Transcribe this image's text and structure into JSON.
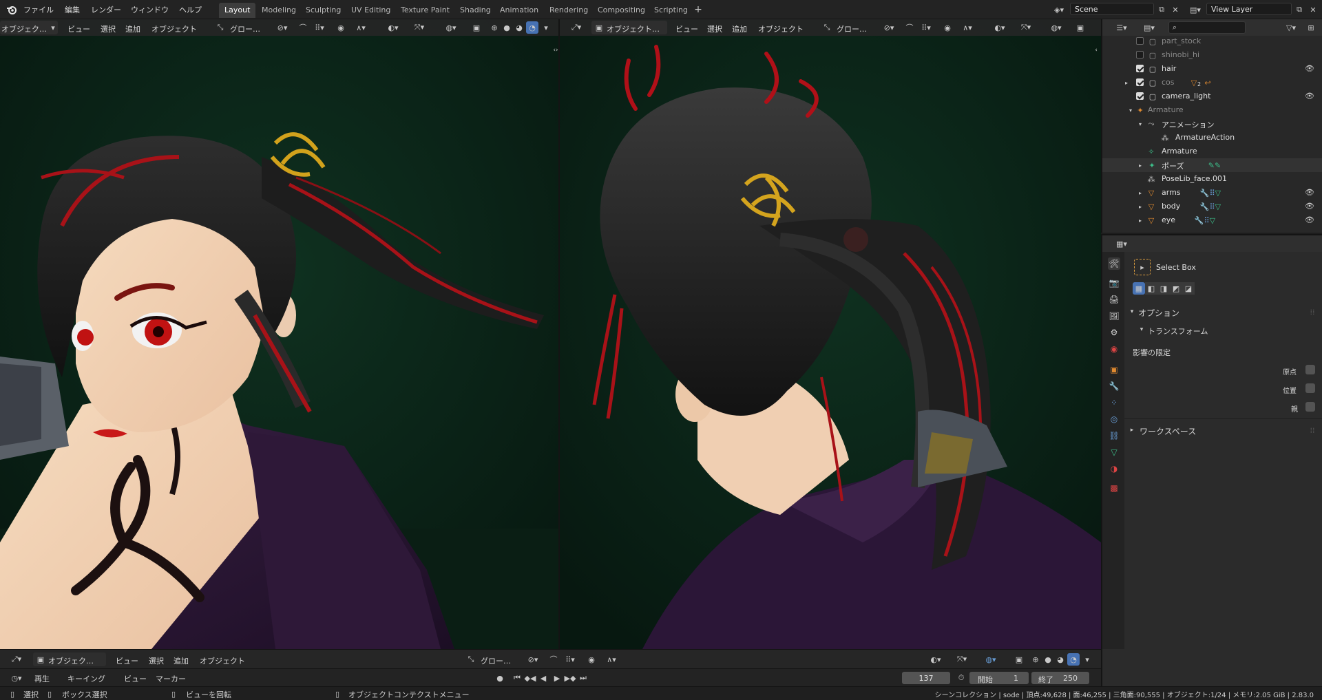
{
  "app": {
    "logo": "blender-logo"
  },
  "menu": [
    "ファイル",
    "編集",
    "レンダー",
    "ウィンドウ",
    "ヘルプ"
  ],
  "workspaces": [
    "Layout",
    "Modeling",
    "Sculpting",
    "UV Editing",
    "Texture Paint",
    "Shading",
    "Animation",
    "Rendering",
    "Compositing",
    "Scripting"
  ],
  "active_workspace": "Layout",
  "scene_name": "Scene",
  "view_layer": "View Layer",
  "viewport_left": {
    "mode": "オブジェク…",
    "menus": [
      "ビュー",
      "選択",
      "追加",
      "オブジェクト"
    ],
    "orientation": "グロー…"
  },
  "viewport_right": {
    "mode": "オブジェクト…",
    "menus": [
      "ビュー",
      "選択",
      "追加",
      "オブジェクト"
    ],
    "orientation": "グロー…"
  },
  "bottom_header": {
    "mode": "オブジェク…",
    "menus": [
      "ビュー",
      "選択",
      "追加",
      "オブジェクト"
    ],
    "orientation": "グロー…"
  },
  "outliner": {
    "search_placeholder": "",
    "rows": [
      {
        "label": "part_stock",
        "checked": false,
        "dim": true,
        "eye": false
      },
      {
        "label": "shinobi_hi",
        "checked": false,
        "dim": true,
        "eye": false
      },
      {
        "label": "hair",
        "checked": true,
        "dim": false,
        "eye": true
      },
      {
        "label": "cos",
        "checked": true,
        "dim": true,
        "eye": false,
        "extra": "2"
      },
      {
        "label": "camera_light",
        "checked": true,
        "dim": false,
        "eye": true
      },
      {
        "label": "Armature",
        "checked": null,
        "dim": true,
        "eye": false
      },
      {
        "label": "アニメーション",
        "checked": null,
        "dim": false,
        "eye": false
      },
      {
        "label": "ArmatureAction",
        "checked": null,
        "dim": false,
        "eye": false
      },
      {
        "label": "Armature",
        "checked": null,
        "dim": false,
        "eye": false
      },
      {
        "label": "ポーズ",
        "checked": null,
        "dim": false,
        "eye": false
      },
      {
        "label": "PoseLib_face.001",
        "checked": null,
        "dim": false,
        "eye": false
      },
      {
        "label": "arms",
        "checked": null,
        "dim": false,
        "eye": true
      },
      {
        "label": "body",
        "checked": null,
        "dim": false,
        "eye": true
      },
      {
        "label": "eye",
        "checked": null,
        "dim": false,
        "eye": true
      }
    ]
  },
  "properties": {
    "tool_name": "Select Box",
    "options_label": "オプション",
    "transform_label": "トランスフォーム",
    "affect_only_label": "影響の限定",
    "checks": [
      "原点",
      "位置",
      "親"
    ],
    "workspace_label": "ワークスペース"
  },
  "timeline": {
    "menus": [
      "再生",
      "キーイング",
      "ビュー",
      "マーカー"
    ],
    "current_frame": "137",
    "start_label": "開始",
    "start_value": "1",
    "end_label": "終了",
    "end_value": "250"
  },
  "statusbar": {
    "select": "選択",
    "box_select": "ボックス選択",
    "rotate_view": "ビューを回転",
    "context_menu": "オブジェクトコンテクストメニュー",
    "stats": "シーンコレクション | sode | 頂点:49,628 | 面:46,255 | 三角面:90,555 | オブジェクト:1/24 | メモリ:2.05 GiB | 2.83.0"
  },
  "colors": {
    "accent": "#4772b3",
    "bg": "#1d1d1d",
    "viewport_bg": "#0e2a1c",
    "hair_red": "#b01018"
  }
}
